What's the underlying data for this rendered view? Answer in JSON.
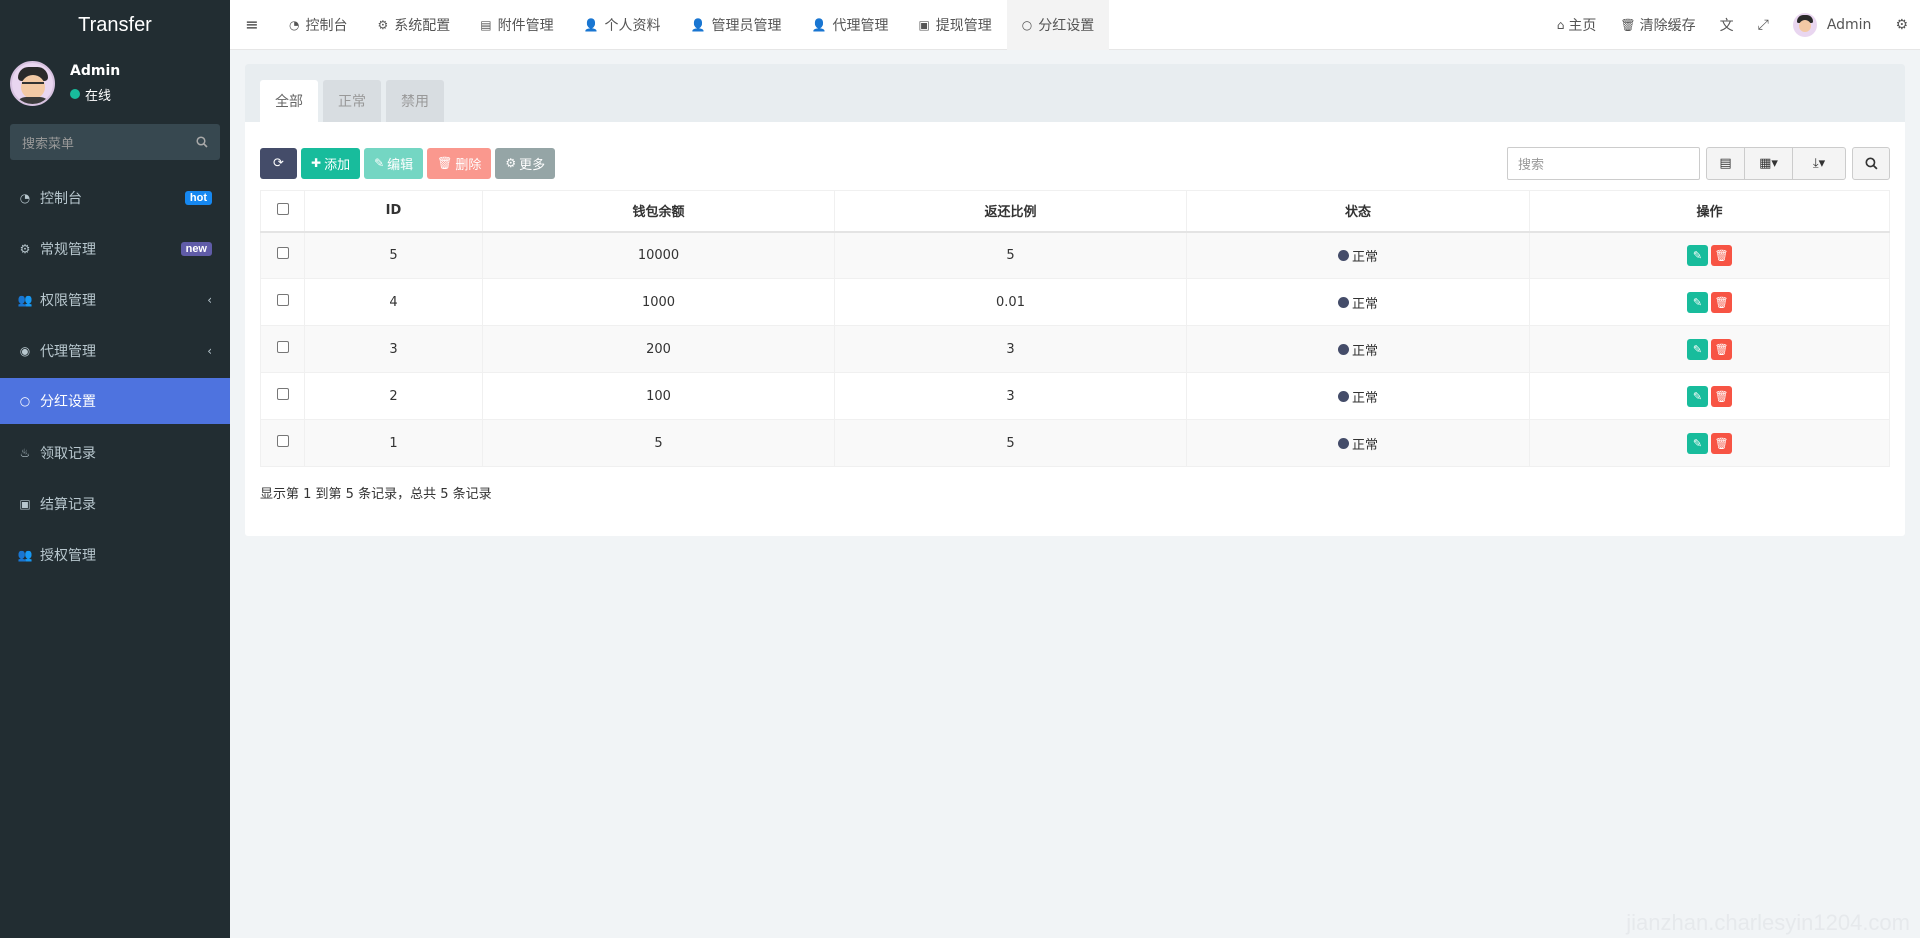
{
  "brand": "Transfer",
  "user": {
    "name": "Admin",
    "status": "在线"
  },
  "sidebar": {
    "search_placeholder": "搜索菜单",
    "items": [
      {
        "label": "控制台",
        "badge": "hot"
      },
      {
        "label": "常规管理",
        "badge": "new"
      },
      {
        "label": "权限管理"
      },
      {
        "label": "代理管理"
      },
      {
        "label": "分红设置"
      },
      {
        "label": "领取记录"
      },
      {
        "label": "结算记录"
      },
      {
        "label": "授权管理"
      }
    ]
  },
  "topnav": {
    "tabs": [
      {
        "label": "控制台"
      },
      {
        "label": "系统配置"
      },
      {
        "label": "附件管理"
      },
      {
        "label": "个人资料"
      },
      {
        "label": "管理员管理"
      },
      {
        "label": "代理管理"
      },
      {
        "label": "提现管理"
      },
      {
        "label": "分红设置"
      }
    ],
    "home": "主页",
    "clear_cache": "清除缓存",
    "admin": "Admin"
  },
  "panel": {
    "tabs": [
      "全部",
      "正常",
      "禁用"
    ],
    "toolbar": {
      "add": "添加",
      "edit": "编辑",
      "delete": "删除",
      "more": "更多",
      "search_placeholder": "搜索"
    },
    "columns": [
      "ID",
      "钱包余额",
      "返还比例",
      "状态",
      "操作"
    ],
    "rows": [
      {
        "id": "5",
        "balance": "10000",
        "ratio": "5",
        "status": "正常"
      },
      {
        "id": "4",
        "balance": "1000",
        "ratio": "0.01",
        "status": "正常"
      },
      {
        "id": "3",
        "balance": "200",
        "ratio": "3",
        "status": "正常"
      },
      {
        "id": "2",
        "balance": "100",
        "ratio": "3",
        "status": "正常"
      },
      {
        "id": "1",
        "balance": "5",
        "ratio": "5",
        "status": "正常"
      }
    ],
    "summary": "显示第 1 到第 5 条记录，总共 5 条记录"
  },
  "watermark": "jianzhan.charlesyin1204.com",
  "colors": {
    "sidebar_bg": "#222d32",
    "active_menu": "#4e73df",
    "success": "#18bc9c",
    "danger": "#f75444",
    "dark_btn": "#444c69"
  }
}
